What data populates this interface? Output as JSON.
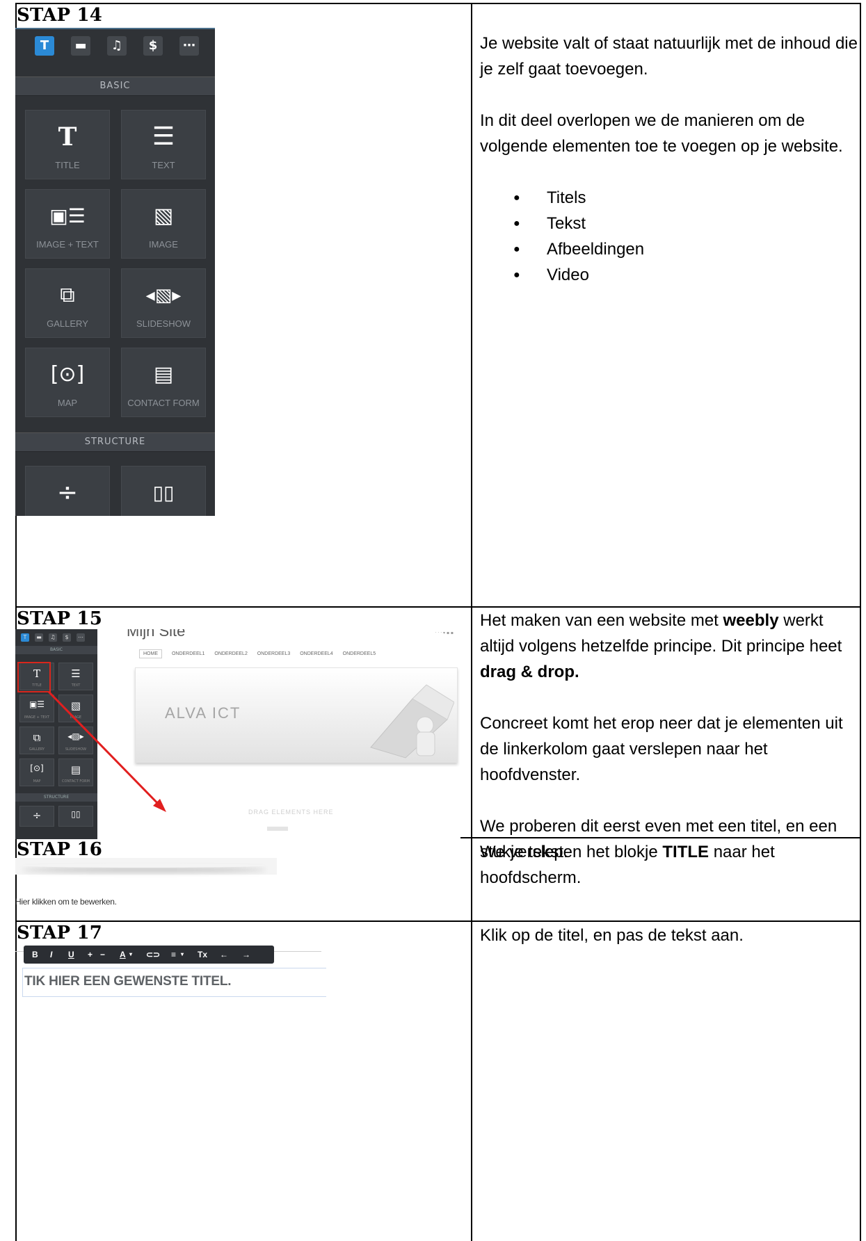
{
  "steps": [
    {
      "label": "STAP 14"
    },
    {
      "label": "STAP 15"
    },
    {
      "label": "STAP 16"
    },
    {
      "label": "STAP 17"
    }
  ],
  "stap14": {
    "paragraphs": [
      "Je website valt of staat natuurlijk met de inhoud die je zelf gaat toevoegen.",
      "In dit deel overlopen we de manieren om de volgende elementen toe te voegen op je website."
    ],
    "bullets": [
      "Titels",
      "Tekst",
      "Afbeeldingen",
      "Video"
    ],
    "sidebar": {
      "tabs": [
        "text-tab-icon",
        "layout-tab-icon",
        "music-tab-icon",
        "dollar-tab-icon",
        "more-tab-icon"
      ],
      "section_basic": "BASIC",
      "section_structure": "STRUCTURE",
      "tiles": [
        {
          "label": "TITLE",
          "icon": "title-icon"
        },
        {
          "label": "TEXT",
          "icon": "text-lines-icon"
        },
        {
          "label": "IMAGE + TEXT",
          "icon": "image-text-icon"
        },
        {
          "label": "IMAGE",
          "icon": "image-icon"
        },
        {
          "label": "GALLERY",
          "icon": "gallery-icon"
        },
        {
          "label": "SLIDESHOW",
          "icon": "slideshow-icon"
        },
        {
          "label": "MAP",
          "icon": "map-pin-icon"
        },
        {
          "label": "CONTACT FORM",
          "icon": "contact-form-icon"
        }
      ]
    }
  },
  "stap15": {
    "text": {
      "p1_a": "Het maken van een website met ",
      "p1_b": "weebly",
      "p1_c": " werkt altijd volgens hetzelfde principe. Dit principe heet ",
      "p1_d": "drag & drop.",
      "p2": "Concreet komt het erop neer dat je elementen uit de linkerkolom gaat verslepen naar het hoofdvenster.",
      "p3": "We proberen dit eerst even met een titel, en een stukje tekst."
    },
    "screenshot": {
      "site_title": "Mijn Site",
      "nav": [
        "HOME",
        "ONDERDEEL1",
        "ONDERDEEL2",
        "ONDERDEEL3",
        "ONDERDEEL4",
        "ONDERDEEL5"
      ],
      "banner_text": "ALVA ICT",
      "drop_zone": "DRAG ELEMENTS HERE",
      "mini_basic": "BASIC",
      "mini_structure": "STRUCTURE",
      "mini_tiles": [
        "TITLE",
        "TEXT",
        "IMAGE + TEXT",
        "IMAGE",
        "GALLERY",
        "SLIDESHOW",
        "MAP",
        "CONTACT FORM"
      ]
    }
  },
  "stap16": {
    "text_a": "We verslepen het blokje ",
    "text_b": "TITLE",
    "text_c": " naar het hoofdscherm.",
    "screenshot_text": "Hier klikken om te bewerken."
  },
  "stap17": {
    "text": "Klik op de titel, en pas de tekst aan.",
    "toolbar": [
      "B",
      "I",
      "U",
      "+",
      "−",
      "A",
      "link",
      "align",
      "Tx",
      "undo",
      "redo"
    ],
    "title_field": "TIK HIER EEN GEWENSTE TITEL."
  }
}
